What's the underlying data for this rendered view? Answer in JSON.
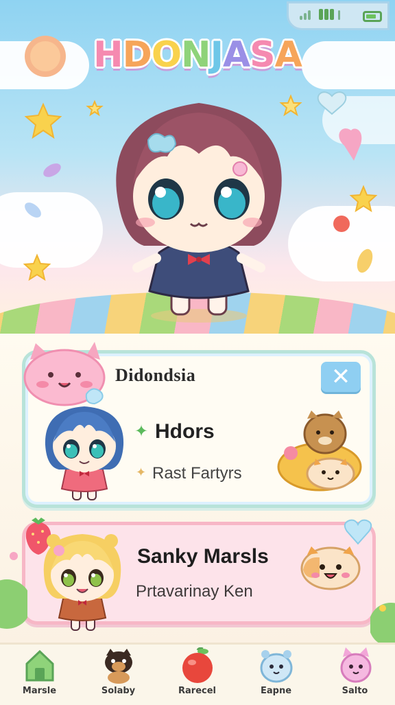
{
  "status_bar": {
    "signal_icon": "signal-bars-icon",
    "battery_icon": "battery-icon",
    "battery_level": 0.8
  },
  "header": {
    "logo_text": "HDONJASA"
  },
  "card_profile": {
    "title": "Didondsia",
    "close_icon": "close-icon",
    "primary_label": "Hdors",
    "secondary_label": "Rast Fartyrs"
  },
  "card_event": {
    "title": "Sanky Marsls",
    "subtitle": "Prtavarinay Ken"
  },
  "nav": {
    "items": [
      {
        "label": "Marsle",
        "icon": "house-icon"
      },
      {
        "label": "Solaby",
        "icon": "dog-icon"
      },
      {
        "label": "Rarecel",
        "icon": "apple-icon"
      },
      {
        "label": "Eapne",
        "icon": "hamster-icon"
      },
      {
        "label": "Salto",
        "icon": "cat-icon"
      }
    ]
  },
  "colors": {
    "sky_top": "#8fd3f2",
    "card1_border": "#b8e3d9",
    "card2_border": "#f7b7c6",
    "close_button": "#8fcff2"
  }
}
